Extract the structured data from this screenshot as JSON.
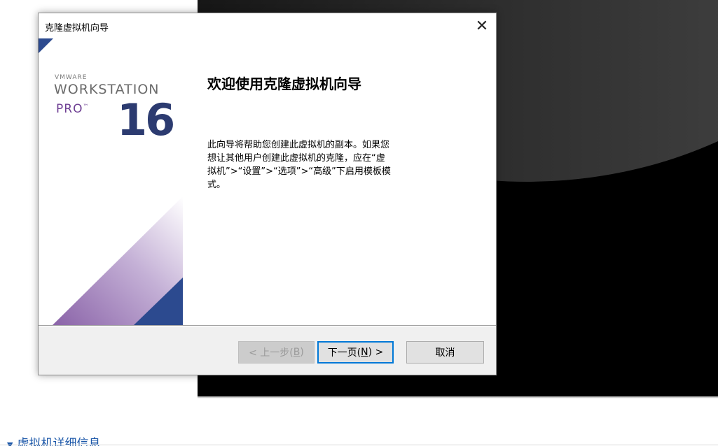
{
  "dialog": {
    "title": "克隆虚拟机向导",
    "close_icon": "close-icon",
    "heading": "欢迎使用克隆虚拟机向导",
    "description": "此向导将帮助您创建此虚拟机的副本。如果您想让其他用户创建此虚拟机的克隆，应在“虚拟机”>“设置”>“选项”>“高级”下启用模板模式。",
    "buttons": {
      "back": {
        "prefix": "< 上一步(",
        "key": "B",
        "suffix": ")",
        "enabled": false
      },
      "next": {
        "prefix": "下一页(",
        "key": "N",
        "suffix": ") >",
        "enabled": true
      },
      "cancel": "取消"
    }
  },
  "banner": {
    "vmware": "VMWARE",
    "product": "WORKSTATION",
    "edition": "PRO",
    "tm": "™",
    "version": "16"
  },
  "background": {
    "section_title": "虚拟机详细信息",
    "expand_icon": "triangle-down-icon"
  },
  "colors": {
    "banner_blue": "#2c4a8f",
    "banner_purple": "#8a63a8",
    "focus_blue": "#0078d7"
  }
}
